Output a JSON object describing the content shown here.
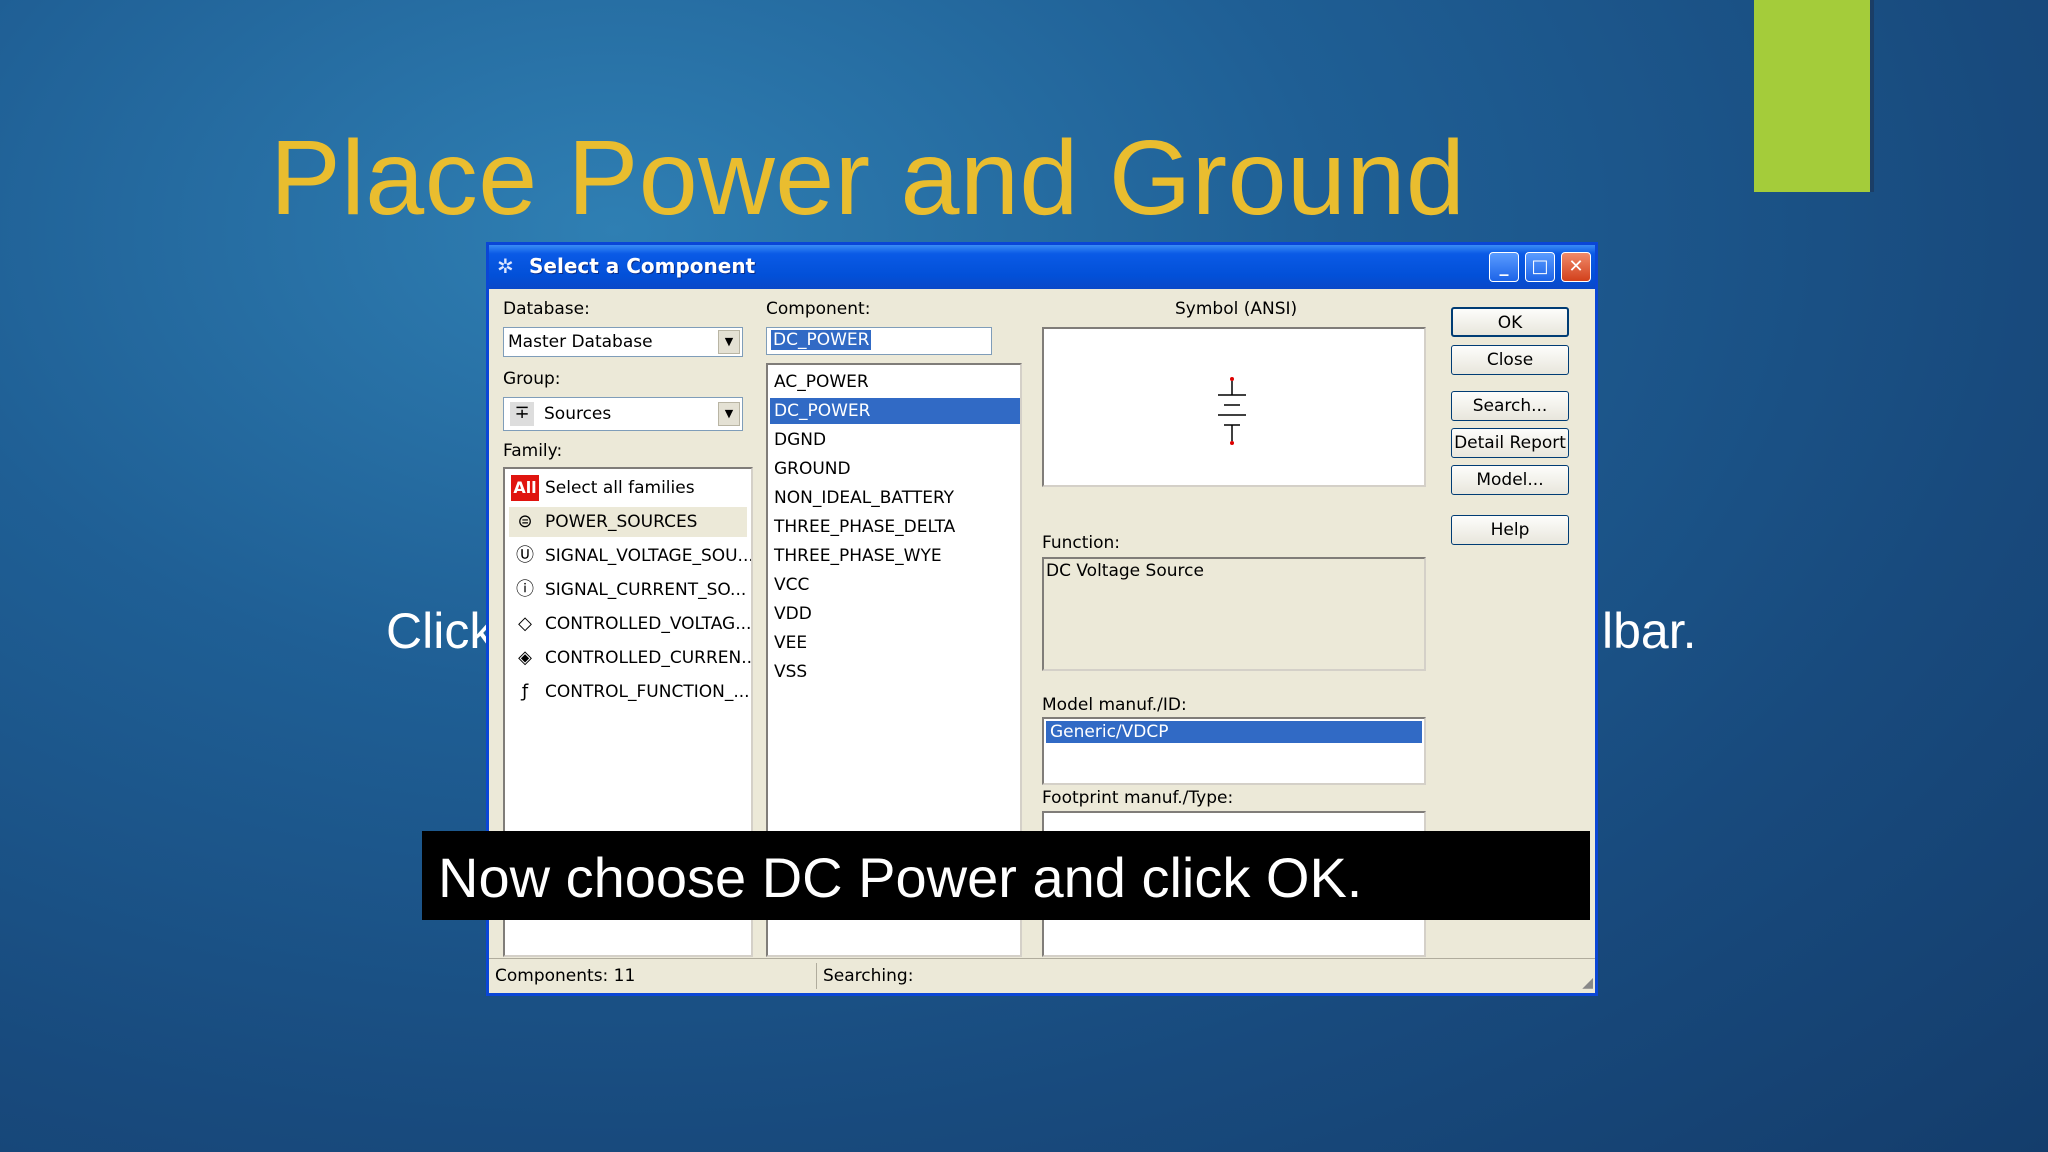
{
  "slide": {
    "title": "Place Power and Ground",
    "body_left_fragment": "Click",
    "body_right_fragment": "lbar.",
    "accent_color": "#a4cc3a",
    "title_color": "#e9bd2f"
  },
  "dialog": {
    "title": "Select a Component",
    "titlebar_buttons": {
      "minimize": "_",
      "maximize": "□",
      "close": "✕"
    },
    "database": {
      "label": "Database:",
      "value": "Master Database"
    },
    "group": {
      "label": "Group:",
      "value": "Sources",
      "icon": "sources-icon"
    },
    "family": {
      "label": "Family:",
      "items": [
        {
          "label": "Select all families",
          "icon": "All"
        },
        {
          "label": "POWER_SOURCES",
          "icon": "power-sources-icon"
        },
        {
          "label": "SIGNAL_VOLTAGE_SOU...",
          "icon": "signal-voltage-icon"
        },
        {
          "label": "SIGNAL_CURRENT_SO...",
          "icon": "signal-current-icon"
        },
        {
          "label": "CONTROLLED_VOLTAG...",
          "icon": "controlled-voltage-icon"
        },
        {
          "label": "CONTROLLED_CURREN...",
          "icon": "controlled-current-icon"
        },
        {
          "label": "CONTROL_FUNCTION_...",
          "icon": "control-function-icon"
        }
      ],
      "selected_index": 1
    },
    "component": {
      "label": "Component:",
      "value": "DC_POWER",
      "items": [
        "AC_POWER",
        "DC_POWER",
        "DGND",
        "GROUND",
        "NON_IDEAL_BATTERY",
        "THREE_PHASE_DELTA",
        "THREE_PHASE_WYE",
        "VCC",
        "VDD",
        "VEE",
        "VSS"
      ],
      "selected_index": 1
    },
    "symbol": {
      "label": "Symbol (ANSI)"
    },
    "function": {
      "label": "Function:",
      "value": "DC Voltage Source"
    },
    "model": {
      "label": "Model manuf./ID:",
      "value": "Generic/VDCP"
    },
    "footprint": {
      "label": "Footprint manuf./Type:"
    },
    "buttons": {
      "ok": "OK",
      "close": "Close",
      "search": "Search...",
      "detail_report": "Detail Report",
      "model": "Model...",
      "help": "Help"
    },
    "status": {
      "components": "Components: 11",
      "searching": "Searching:"
    },
    "selection_color": "#316ac5"
  },
  "caption": "Now choose DC Power and click OK."
}
